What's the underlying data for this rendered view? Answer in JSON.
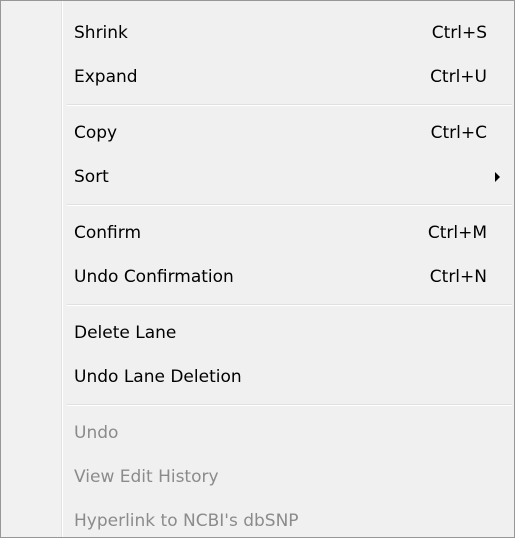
{
  "menu": {
    "groups": [
      {
        "items": [
          {
            "label": "Shrink",
            "shortcut": "Ctrl+S"
          },
          {
            "label": "Expand",
            "shortcut": "Ctrl+U"
          }
        ]
      },
      {
        "items": [
          {
            "label": "Copy",
            "shortcut": "Ctrl+C"
          },
          {
            "label": "Sort",
            "shortcut": "",
            "submenu": true
          }
        ]
      },
      {
        "items": [
          {
            "label": "Confirm",
            "shortcut": "Ctrl+M"
          },
          {
            "label": "Undo Confirmation",
            "shortcut": "Ctrl+N"
          }
        ]
      },
      {
        "items": [
          {
            "label": "Delete Lane",
            "shortcut": ""
          },
          {
            "label": "Undo Lane Deletion",
            "shortcut": ""
          }
        ]
      },
      {
        "items": [
          {
            "label": "Undo",
            "shortcut": "",
            "disabled": true
          },
          {
            "label": "View Edit History",
            "shortcut": "",
            "disabled": true
          },
          {
            "label": "Hyperlink to NCBI's dbSNP",
            "shortcut": "",
            "disabled": true
          }
        ]
      }
    ],
    "colors": {
      "background": "#f0f0f0",
      "border": "#979797",
      "text": "#000000",
      "disabled_text": "#8b8b8b",
      "separator": "#e0e0e0"
    }
  }
}
